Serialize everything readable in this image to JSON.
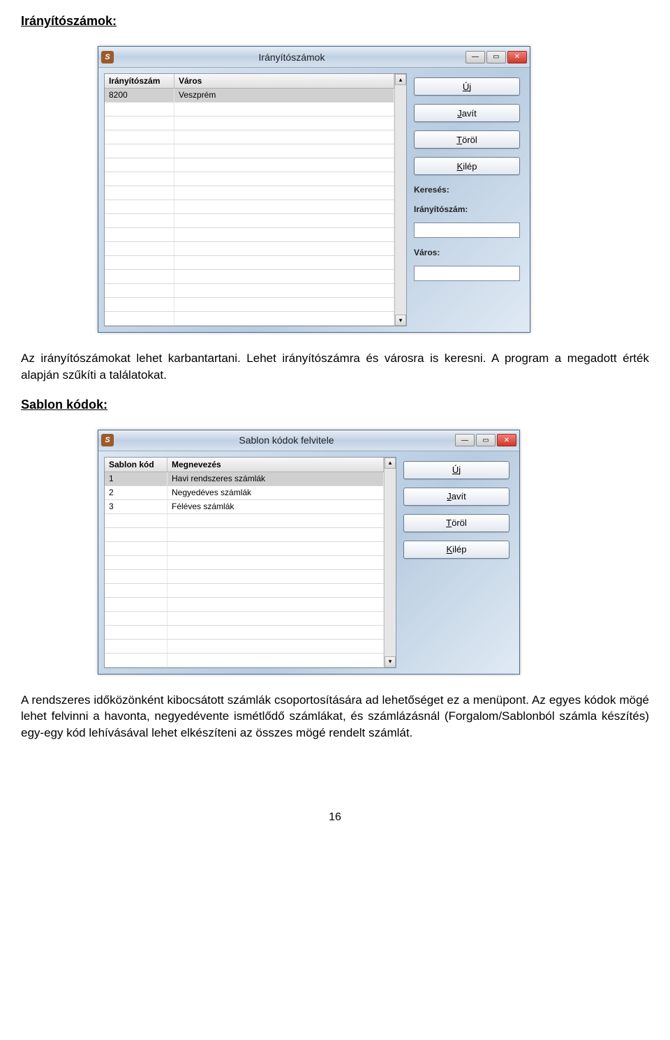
{
  "headings": {
    "section1": "Irányítószámok:",
    "section2": "Sablon kódok:"
  },
  "paragraphs": {
    "p1": "Az irányítószámokat lehet karbantartani. Lehet irányítószámra és városra is keresni. A program a megadott érték alapján szűkíti a találatokat.",
    "p2": "A rendszeres időközönként kibocsátott számlák csoportosítására ad lehetőséget ez a menüpont. Az egyes kódok mögé lehet felvinni a havonta, negyedévente ismétlődő számlákat, és számlázásnál (Forgalom/Sablonból számla készítés) egy-egy kód lehívásával lehet elkészíteni az összes mögé rendelt számlát."
  },
  "window1": {
    "title": "Irányítószámok",
    "app_icon_text": "S",
    "columns": {
      "a": "Irányítószám",
      "b": "Város"
    },
    "rows": [
      {
        "a": "8200",
        "b": "Veszprém"
      }
    ],
    "buttons": {
      "new_u": "Ú",
      "new_rest": "j",
      "edit_u": "J",
      "edit_rest": "avít",
      "del_u": "T",
      "del_rest": "öröl",
      "exit_u": "K",
      "exit_rest": "ilép"
    },
    "search": {
      "label": "Keresés:",
      "field1_label": "Irányítószám:",
      "field1_value": "",
      "field2_label": "Város:",
      "field2_value": ""
    }
  },
  "window2": {
    "title": "Sablon kódok felvitele",
    "app_icon_text": "S",
    "columns": {
      "a": "Sablon kód",
      "b": "Megnevezés"
    },
    "rows": [
      {
        "a": "1",
        "b": "Havi rendszeres számlák"
      },
      {
        "a": "2",
        "b": "Negyedéves számlák"
      },
      {
        "a": "3",
        "b": "Féléves számlák"
      }
    ],
    "buttons": {
      "new_u": "Ú",
      "new_rest": "j",
      "edit_u": "J",
      "edit_rest": "avít",
      "del_u": "T",
      "del_rest": "öröl",
      "exit_u": "K",
      "exit_rest": "ilép"
    }
  },
  "page_number": "16"
}
